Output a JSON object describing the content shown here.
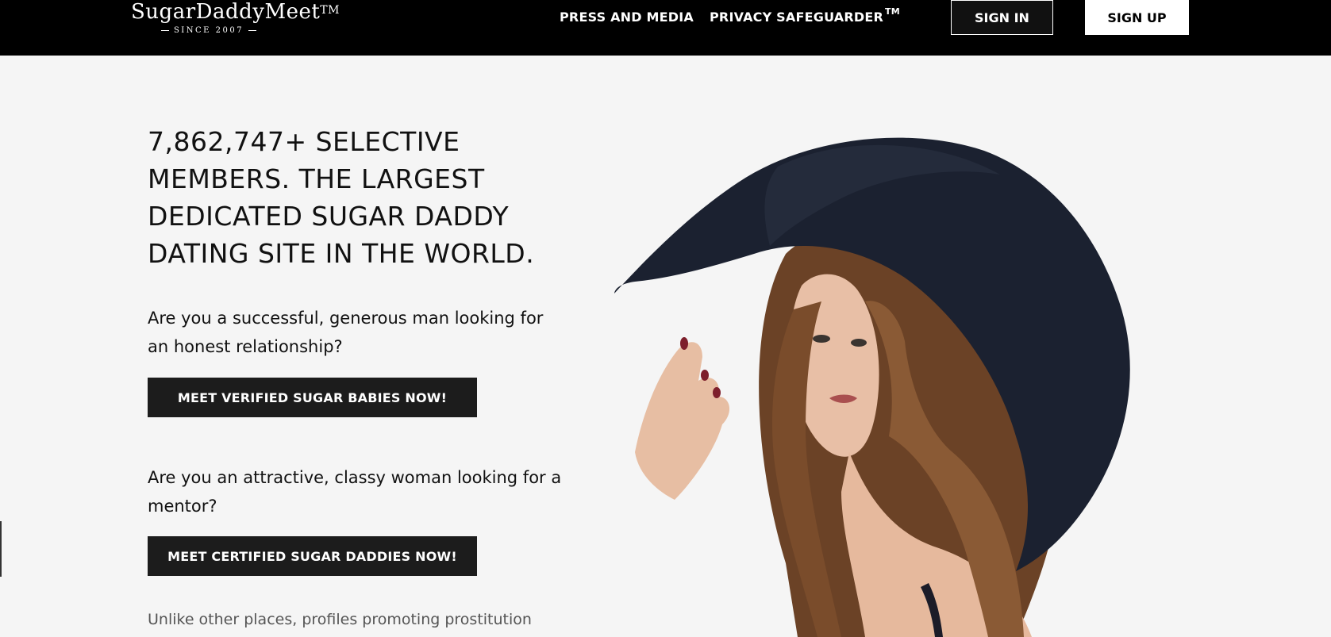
{
  "header": {
    "logo": {
      "name": "SugarDaddyMeet",
      "tm": "TM",
      "tagline": "SINCE 2007"
    },
    "nav": {
      "press": "PRESS AND MEDIA",
      "privacy": "PRIVACY SAFEGUARDER",
      "privacy_tm": "TM"
    },
    "sign_in": "SIGN IN",
    "sign_up": "SIGN UP"
  },
  "main": {
    "headline": "7,862,747+ SELECTIVE MEMBERS. THE LARGEST DEDICATED SUGAR DADDY DATING SITE IN THE WORLD.",
    "question_men": "Are you a successful, generous man looking for an honest relationship?",
    "cta_men": "MEET VERIFIED SUGAR BABIES NOW!",
    "question_women": "Are you an attractive, classy woman looking for a mentor?",
    "cta_women": "MEET CERTIFIED SUGAR DADDIES NOW!",
    "footnote": "Unlike other places, profiles promoting prostitution"
  },
  "colors": {
    "header_bg": "#000000",
    "page_bg": "#f5f5f5",
    "cta_bg": "#1c1c1c",
    "hat": "#1b2130",
    "hair": "#6b4226"
  }
}
